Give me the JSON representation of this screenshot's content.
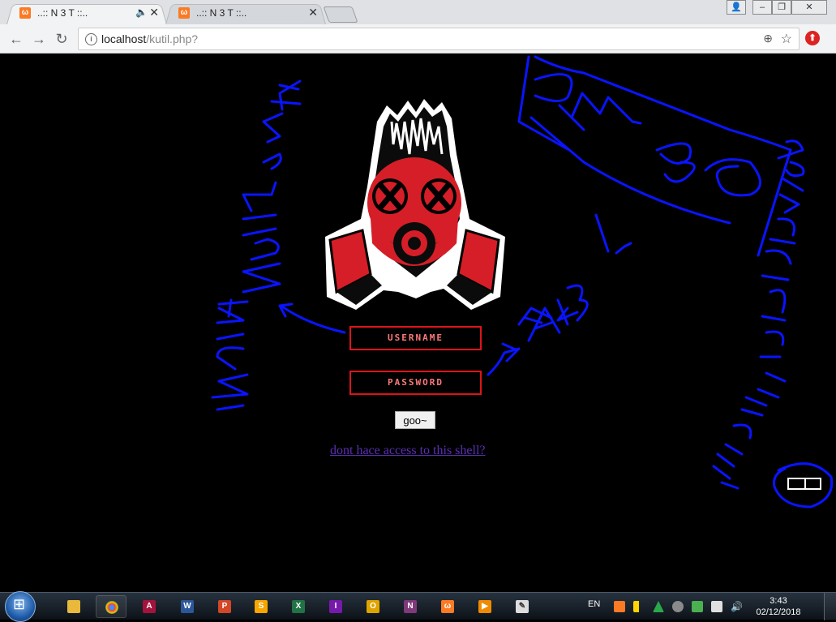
{
  "browser": {
    "tabs": [
      {
        "title": "..:: N 3 T ::..",
        "active": true,
        "audio": true
      },
      {
        "title": "..:: N 3 T ::..",
        "active": false,
        "audio": false
      }
    ],
    "address": {
      "host": "localhost",
      "path": "/kutil.php?"
    }
  },
  "login": {
    "username_placeholder": "USERNAME",
    "password_placeholder": "PASSWORD",
    "submit_label": "goo~",
    "link_text": "dont hace access to this shell?"
  },
  "annotations": {
    "left": "INPUE N3T I2 3N",
    "center": "FAK3 !",
    "top_right": "KMB",
    "right": "INPUE Pass Sneb28"
  },
  "taskbar": {
    "language": "EN",
    "time": "3:43",
    "date": "02/12/2018",
    "apps": [
      "file-explorer",
      "chrome",
      "access",
      "word",
      "powerpoint",
      "scratch",
      "excel",
      "infopath",
      "outlook",
      "onenote",
      "xampp",
      "media-player",
      "notepad"
    ]
  },
  "colors": {
    "accent": "#e0131a",
    "scribble": "#0a14ff",
    "link": "#5a2fb2"
  }
}
